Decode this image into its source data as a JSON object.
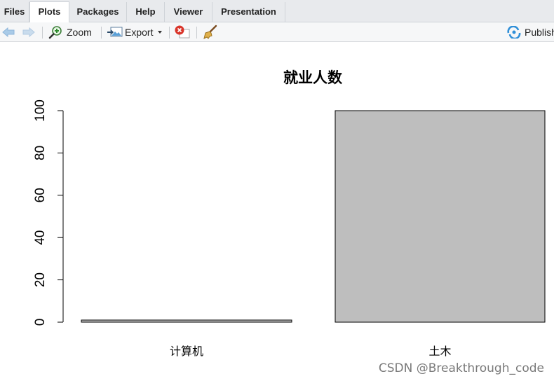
{
  "tabs": [
    "Files",
    "Plots",
    "Packages",
    "Help",
    "Viewer",
    "Presentation"
  ],
  "active_tab": "Plots",
  "toolbar": {
    "zoom_label": "Zoom",
    "export_label": "Export",
    "publish_label": "Publish"
  },
  "icons": {
    "back": "arrow-left-icon",
    "forward": "arrow-right-icon",
    "zoom": "zoom-magnifier-icon",
    "export": "export-image-icon",
    "remove": "remove-plot-icon",
    "clear": "broom-icon",
    "publish": "publish-icon"
  },
  "colors": {
    "bar_fill": "#bebebe",
    "bar_stroke": "#000000"
  },
  "chart_data": {
    "type": "bar",
    "title": "就业人数",
    "categories": [
      "计算机",
      "土木"
    ],
    "values": [
      1,
      100
    ],
    "yticks": [
      0,
      20,
      40,
      60,
      80,
      100
    ],
    "ylim": [
      0,
      100
    ],
    "xlabel": "",
    "ylabel": "",
    "grid": false
  },
  "watermark": "CSDN @Breakthrough_code"
}
